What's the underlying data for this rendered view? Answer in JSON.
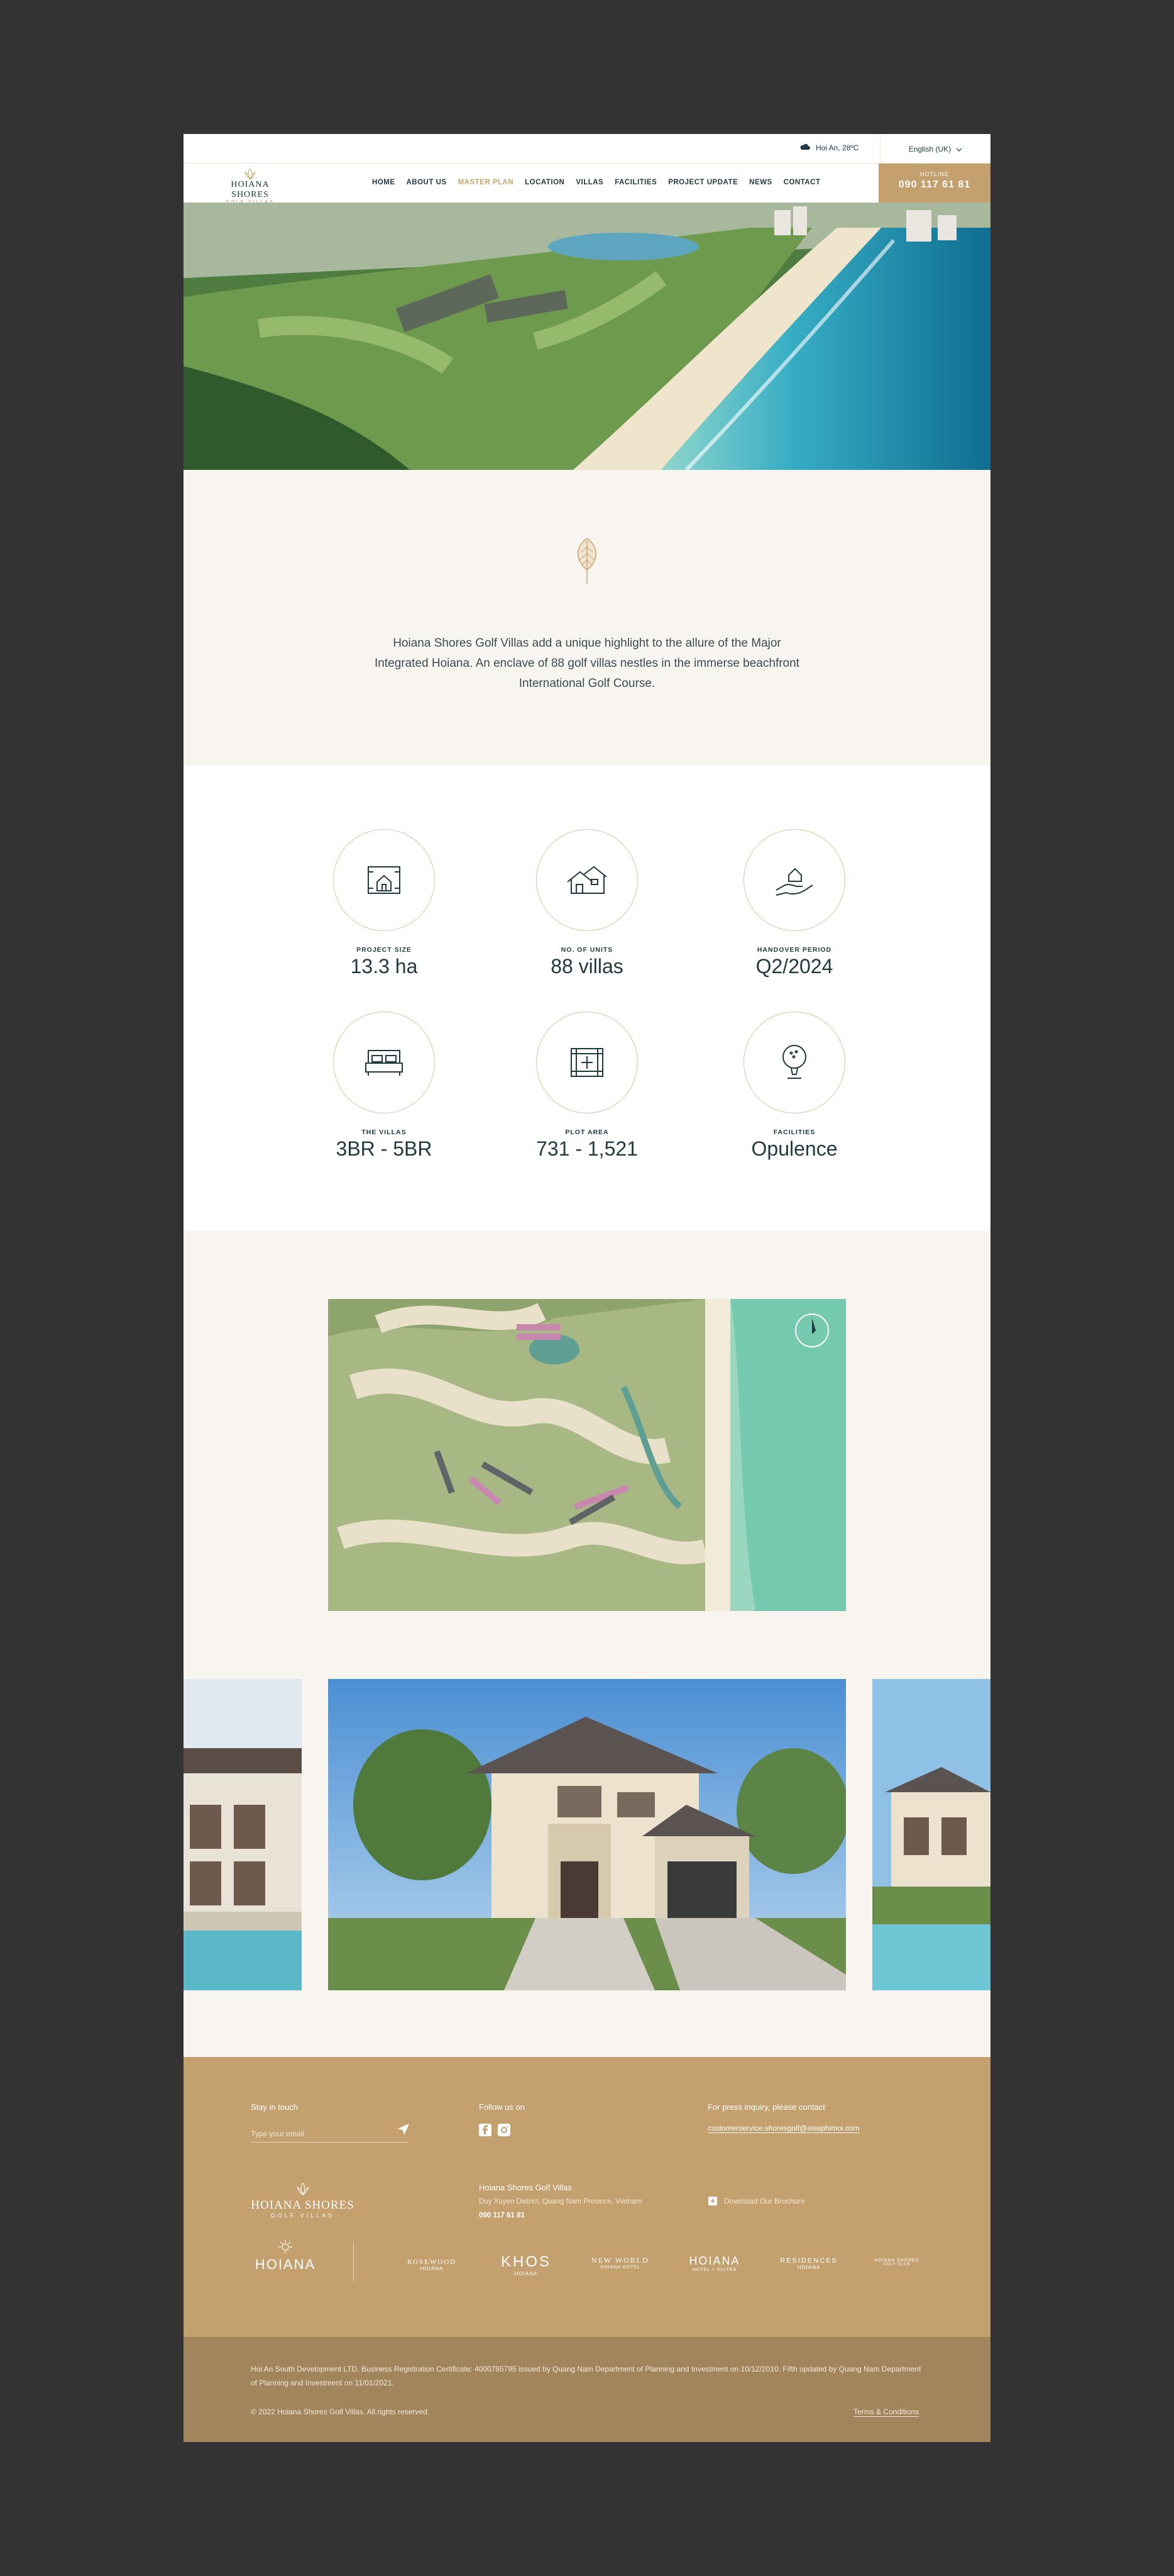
{
  "topbar": {
    "weather": "Hoi An, 28ºC",
    "language": "English (UK)"
  },
  "nav": {
    "logo_text": "HOIANA SHORES",
    "logo_sub": "GOLF VILLAS",
    "items": [
      "HOME",
      "ABOUT US",
      "MASTER PLAN",
      "LOCATION",
      "VILLAS",
      "FACILITIES",
      "PROJECT UPDATE",
      "NEWS",
      "CONTACT"
    ],
    "active_item": "MASTER PLAN",
    "hotline_label": "HOTLINE",
    "hotline_number": "090 117 61 81"
  },
  "intro": {
    "text": "Hoiana Shores Golf Villas add a unique highlight to the allure of the Major Integrated Hoiana. An enclave of 88 golf villas nestles in the immerse beachfront International Golf Course."
  },
  "stats": [
    {
      "label": "PROJECT SIZE",
      "value": "13.3 ha",
      "icon": "plan-house-icon"
    },
    {
      "label": "NO. OF UNITS",
      "value": "88 villas",
      "icon": "house-icon"
    },
    {
      "label": "HANDOVER PERIOD",
      "value": "Q2/2024",
      "icon": "hand-house-icon"
    },
    {
      "label": "THE VILLAS",
      "value": "3BR - 5BR",
      "icon": "bed-icon"
    },
    {
      "label": "PLOT AREA",
      "value": "731 - 1,521",
      "icon": "plot-area-icon"
    },
    {
      "label": "FACILITIES",
      "value": "Opulence",
      "icon": "golf-ball-icon"
    }
  ],
  "footer": {
    "stay_in_touch": "Stay in touch",
    "email_placeholder": "Type your email",
    "follow_us": "Follow us on",
    "press_inquiry": "For press inquiry, please contact",
    "press_email": "customerservice.shoresgolf@asiaphimoi.com",
    "logo_text": "HOIANA SHORES",
    "logo_sub": "GOLF VILLAS",
    "company_name": "Hoiana Shores Golf Villas",
    "address": "Duy Xuyen District, Quang Nam Province, Vietnam",
    "phone": "090 117 61 81",
    "brochure": "Download Our Brochure",
    "partners": [
      "HOIANA",
      "ROSEWOOD",
      "KHOS",
      "NEW WORLD",
      "HOIANA",
      "RESIDENCES",
      "HOIANA SHORES"
    ],
    "partner_subs": [
      "",
      "HOIANA",
      "HOIANA",
      "HOIANA HOTEL",
      "HOTEL + SUITES",
      "HOIANA",
      "GOLF CLUB"
    ],
    "legal": "Hoi An South Development LTD. Business Registration Certificate: 4000785795 issued by Quang Nam Department of Planning and Investment on 10/12/2010. Fifth updated by Quang Nam Department of Planning and Investment on 11/01/2021.",
    "copyright": "© 2022 Hoiana Shores Golf Villas. All rights reserved.",
    "terms": "Terms & Conditions"
  }
}
